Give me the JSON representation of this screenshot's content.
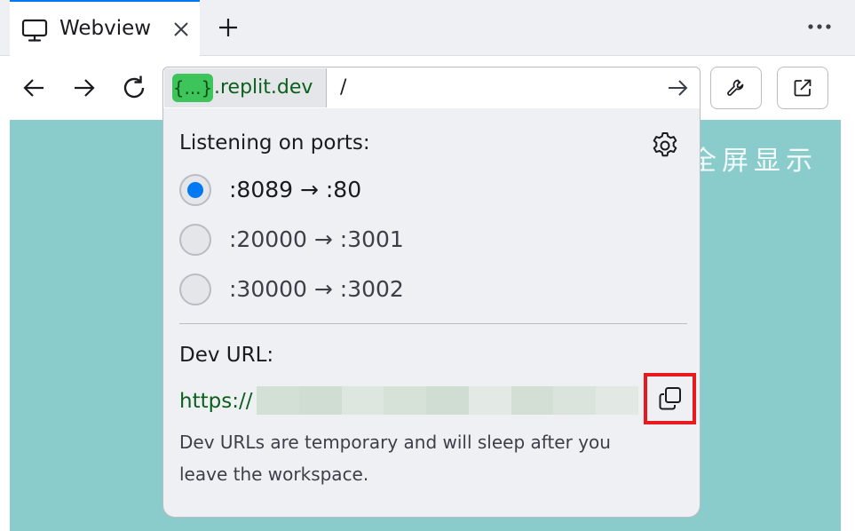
{
  "tab": {
    "title": "Webview",
    "icon": "monitor-icon"
  },
  "address": {
    "host_badge": "{...}",
    "host_suffix": ".replit.dev",
    "path": "/"
  },
  "background_text": "全屏显示",
  "popover": {
    "ports_title": "Listening on ports:",
    "ports": [
      {
        "label": ":8089 → :80",
        "selected": true
      },
      {
        "label": ":20000 → :3001",
        "selected": false
      },
      {
        "label": ":30000 → :3002",
        "selected": false
      }
    ],
    "dev_url_title": "Dev URL:",
    "dev_url_prefix": "https://",
    "note": "Dev URLs are temporary and will sleep after you leave the workspace."
  },
  "colors": {
    "accent": "#0079f2",
    "content_bg": "#89cccb",
    "url_green": "#0b5f1c",
    "highlight": "#e8191f"
  }
}
